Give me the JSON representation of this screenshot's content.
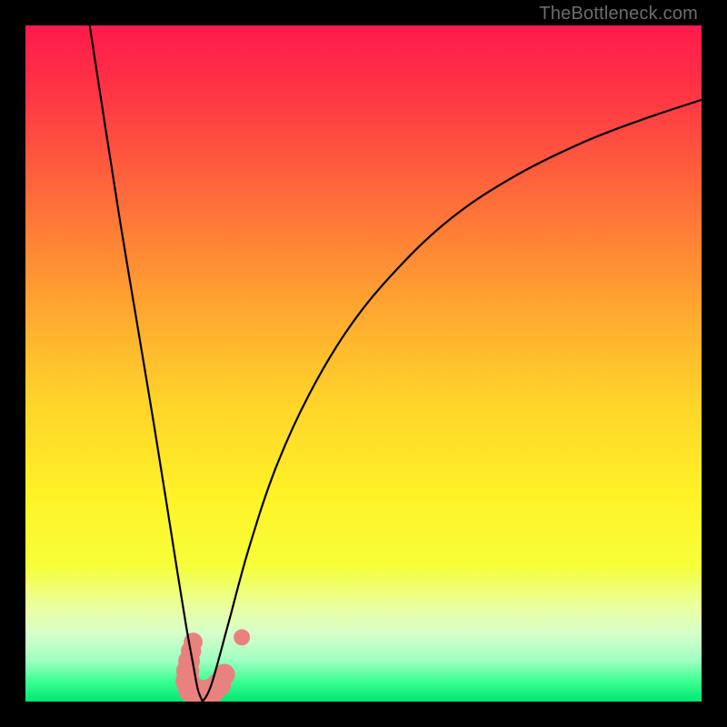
{
  "watermark": "TheBottleneck.com",
  "chart_data": {
    "type": "line",
    "title": "",
    "xlabel": "",
    "ylabel": "",
    "xlim": [
      0,
      1
    ],
    "ylim": [
      0,
      1
    ],
    "gradient_stops": [
      {
        "offset": 0.0,
        "color": "#ff1a4b"
      },
      {
        "offset": 0.1,
        "color": "#ff3545"
      },
      {
        "offset": 0.25,
        "color": "#ff6a3a"
      },
      {
        "offset": 0.4,
        "color": "#ffa031"
      },
      {
        "offset": 0.55,
        "color": "#ffd22a"
      },
      {
        "offset": 0.7,
        "color": "#fff327"
      },
      {
        "offset": 0.8,
        "color": "#f6ff3a"
      },
      {
        "offset": 0.86,
        "color": "#eaffa1"
      },
      {
        "offset": 0.9,
        "color": "#d6ffca"
      },
      {
        "offset": 0.94,
        "color": "#9effc1"
      },
      {
        "offset": 0.97,
        "color": "#3cff91"
      },
      {
        "offset": 1.0,
        "color": "#00e774"
      }
    ],
    "series": [
      {
        "name": "left-branch",
        "points": [
          {
            "x": 0.095,
            "y": 1.0
          },
          {
            "x": 0.115,
            "y": 0.87
          },
          {
            "x": 0.14,
            "y": 0.71
          },
          {
            "x": 0.165,
            "y": 0.56
          },
          {
            "x": 0.19,
            "y": 0.41
          },
          {
            "x": 0.21,
            "y": 0.285
          },
          {
            "x": 0.225,
            "y": 0.19
          },
          {
            "x": 0.238,
            "y": 0.11
          },
          {
            "x": 0.248,
            "y": 0.055
          },
          {
            "x": 0.255,
            "y": 0.018
          },
          {
            "x": 0.262,
            "y": 0.0
          }
        ]
      },
      {
        "name": "right-branch",
        "points": [
          {
            "x": 0.262,
            "y": 0.0
          },
          {
            "x": 0.275,
            "y": 0.025
          },
          {
            "x": 0.3,
            "y": 0.115
          },
          {
            "x": 0.33,
            "y": 0.225
          },
          {
            "x": 0.37,
            "y": 0.345
          },
          {
            "x": 0.42,
            "y": 0.455
          },
          {
            "x": 0.48,
            "y": 0.555
          },
          {
            "x": 0.55,
            "y": 0.64
          },
          {
            "x": 0.63,
            "y": 0.715
          },
          {
            "x": 0.72,
            "y": 0.775
          },
          {
            "x": 0.82,
            "y": 0.825
          },
          {
            "x": 0.91,
            "y": 0.86
          },
          {
            "x": 1.0,
            "y": 0.89
          }
        ]
      }
    ],
    "highlight_blob": {
      "name": "pink-marker",
      "color": "#e9817f",
      "points": [
        {
          "x": 0.248,
          "y": 0.088,
          "r": 0.014
        },
        {
          "x": 0.245,
          "y": 0.075,
          "r": 0.015
        },
        {
          "x": 0.242,
          "y": 0.06,
          "r": 0.016
        },
        {
          "x": 0.24,
          "y": 0.045,
          "r": 0.017
        },
        {
          "x": 0.24,
          "y": 0.03,
          "r": 0.018
        },
        {
          "x": 0.245,
          "y": 0.018,
          "r": 0.019
        },
        {
          "x": 0.255,
          "y": 0.013,
          "r": 0.02
        },
        {
          "x": 0.266,
          "y": 0.012,
          "r": 0.02
        },
        {
          "x": 0.276,
          "y": 0.016,
          "r": 0.019
        },
        {
          "x": 0.286,
          "y": 0.025,
          "r": 0.018
        },
        {
          "x": 0.294,
          "y": 0.04,
          "r": 0.016
        }
      ],
      "dot": {
        "x": 0.32,
        "y": 0.095,
        "r": 0.012
      }
    }
  }
}
